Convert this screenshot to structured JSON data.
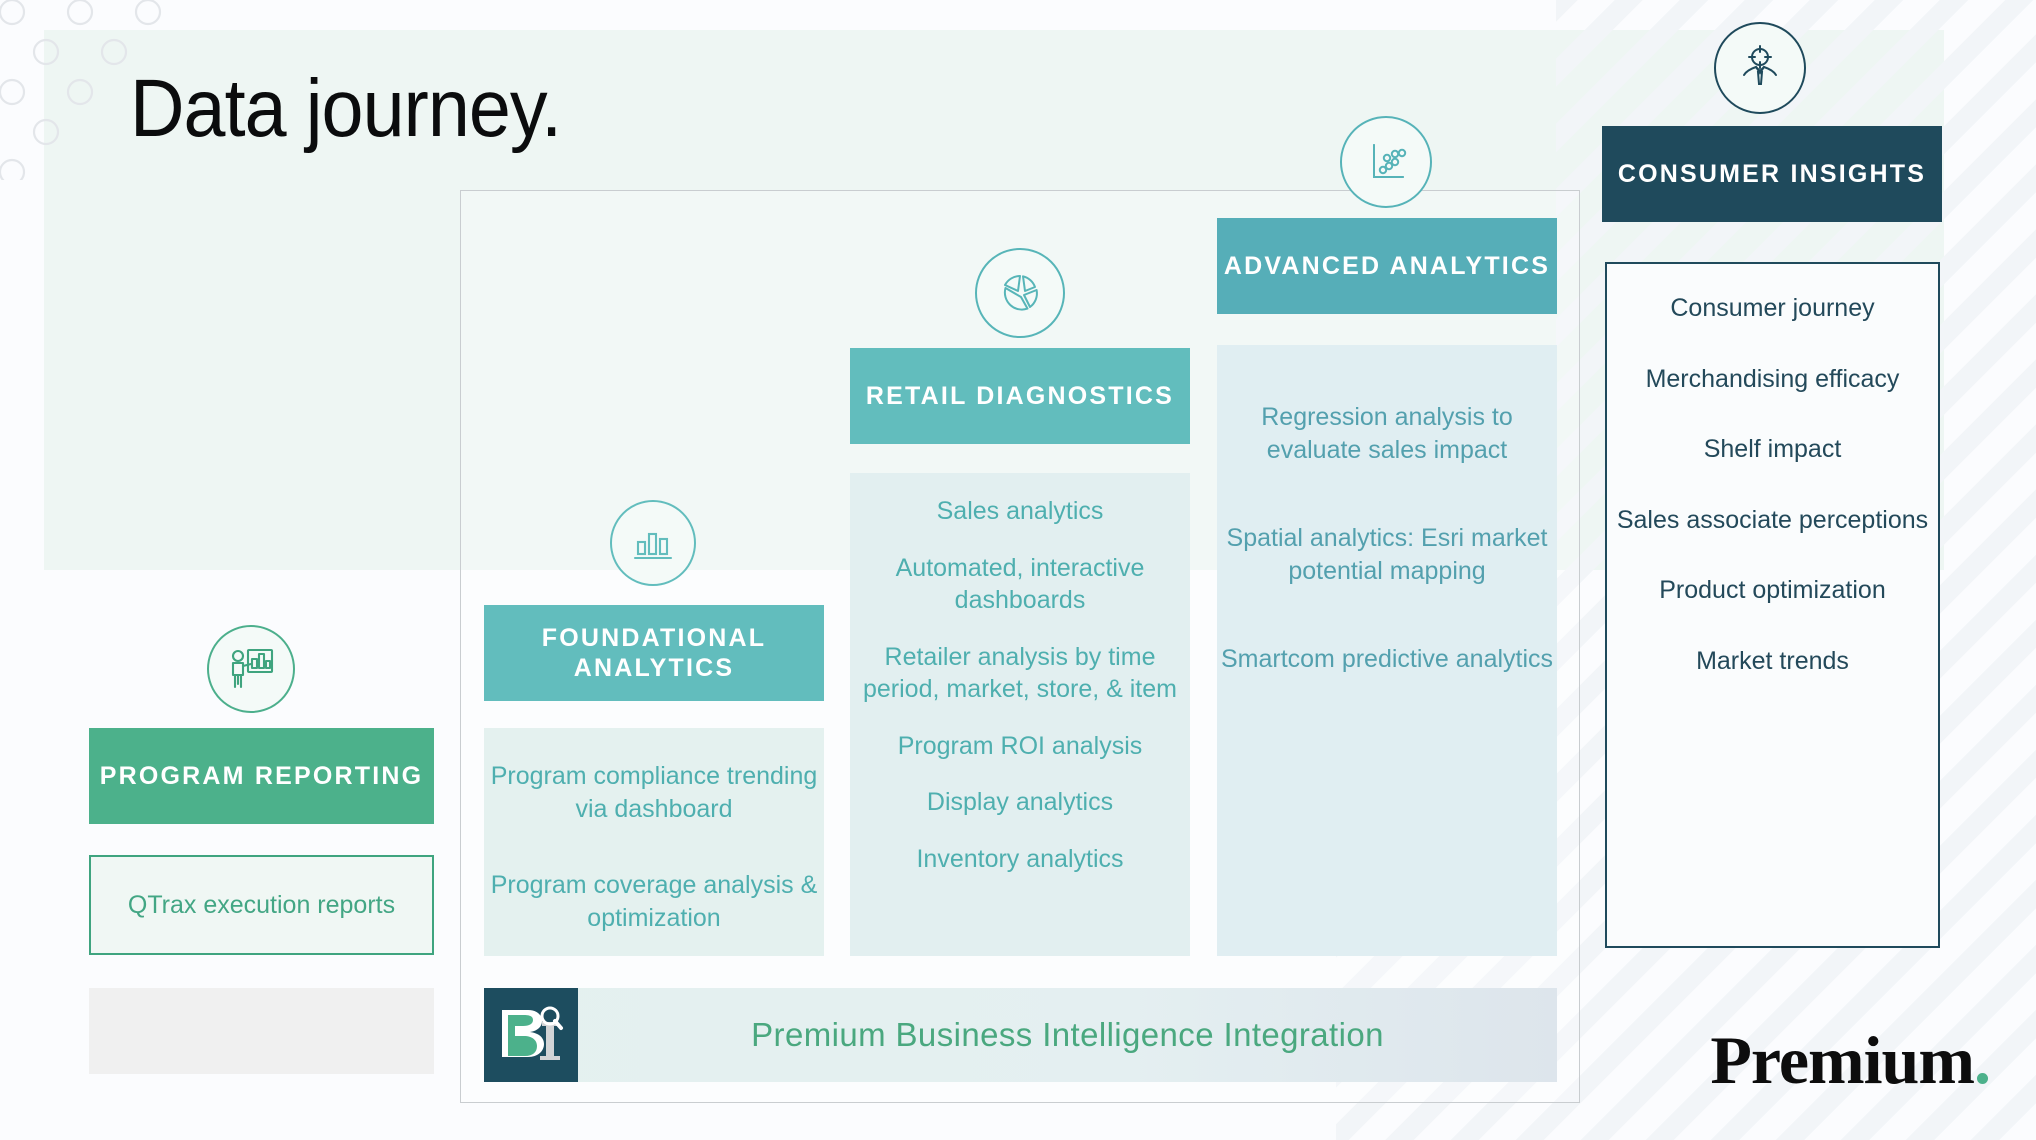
{
  "slide": {
    "title": "Data journey."
  },
  "colors": {
    "green": "#4cb18b",
    "teal": "#62bdbd",
    "teal_dark": "#56aeb8",
    "navy": "#1f4a5c",
    "mint_bg": "#eef6f3"
  },
  "program_reporting": {
    "icon": "presenter-chart-icon",
    "band_label": "PROGRAM REPORTING",
    "items": [
      "QTrax execution reports"
    ]
  },
  "foundational_analytics": {
    "icon": "bar-chart-icon",
    "band_label": "FOUNDATIONAL ANALYTICS",
    "items": [
      "Program compliance trending via dashboard",
      "Program coverage analysis & optimization"
    ]
  },
  "retail_diagnostics": {
    "icon": "donut-chart-icon",
    "band_label": "RETAIL DIAGNOSTICS",
    "items": [
      "Sales analytics",
      "Automated, interactive dashboards",
      "Retailer analysis by time period, market, store, & item",
      "Program ROI analysis",
      "Display analytics",
      "Inventory analytics"
    ]
  },
  "advanced_analytics": {
    "icon": "scatter-plot-icon",
    "band_label": "ADVANCED ANALYTICS",
    "items": [
      "Regression analysis to evaluate sales impact",
      "Spatial analytics: Esri market potential mapping",
      "Smartcom predictive analytics"
    ]
  },
  "consumer_insights": {
    "icon": "target-person-icon",
    "band_label": "CONSUMER INSIGHTS",
    "items": [
      "Consumer journey",
      "Merchandising efficacy",
      "Shelf impact",
      "Sales associate perceptions",
      "Product optimization",
      "Market trends"
    ]
  },
  "bi_bar": {
    "logo": "premium-bi-logo",
    "label": "Premium Business Intelligence Integration"
  },
  "brand": {
    "wordmark": "Premium",
    "dot": "."
  }
}
